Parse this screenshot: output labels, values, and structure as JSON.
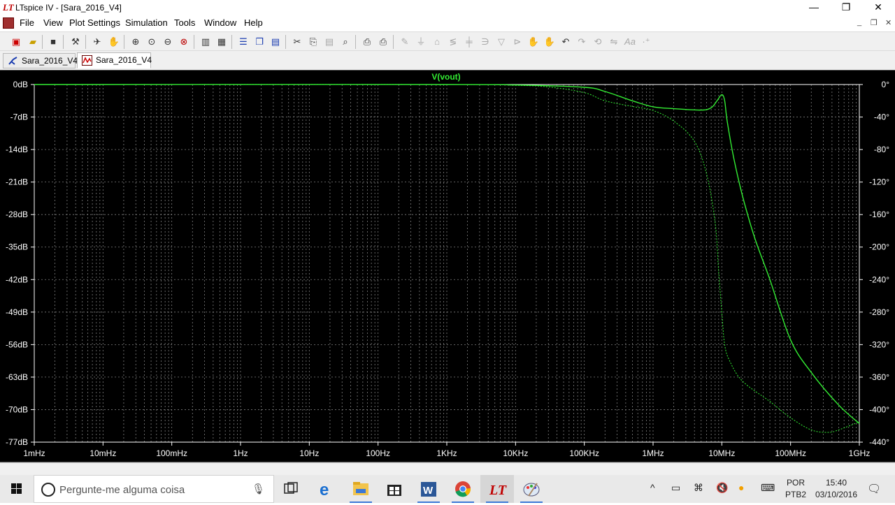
{
  "window": {
    "title": "LTspice IV - [Sara_2016_V4]",
    "app_logo": "LT",
    "controls": {
      "minimize": "—",
      "restore": "❐",
      "close": "✕"
    },
    "mdi_controls": {
      "minimize": "_",
      "restore": "❐",
      "close": "✕"
    }
  },
  "menu": [
    "File",
    "View",
    "Plot Settings",
    "Simulation",
    "Tools",
    "Window",
    "Help"
  ],
  "toolbar_icons": [
    "new-schematic",
    "open",
    "save",
    "control-panel",
    "run",
    "pan",
    "zoom-in",
    "zoom-full",
    "zoom-out",
    "cancel-zoom",
    "autorange",
    "zoom-to-fit",
    "tile-horizontal",
    "cascade",
    "tile-vertical",
    "cut",
    "copy",
    "paste",
    "find",
    "print-preview",
    "print",
    "wire",
    "ground",
    "label-net",
    "resistor",
    "capacitor",
    "inductor",
    "diode",
    "component",
    "move",
    "drag",
    "undo",
    "redo",
    "rotate",
    "mirror",
    "text",
    "spice-directive"
  ],
  "tabs": [
    {
      "label": "Sara_2016_V4",
      "icon": "schematic-icon",
      "active": false
    },
    {
      "label": "Sara_2016_V4",
      "icon": "waveform-icon",
      "active": true
    }
  ],
  "plot": {
    "trace_label": "V(vout)",
    "trace_color": "#33ee33",
    "background": "#000000",
    "grid_color": "#808080",
    "left_axis_ticks": [
      "0dB",
      "-7dB",
      "-14dB",
      "-21dB",
      "-28dB",
      "-35dB",
      "-42dB",
      "-49dB",
      "-56dB",
      "-63dB",
      "-70dB",
      "-77dB"
    ],
    "right_axis_ticks": [
      "0°",
      "-40°",
      "-80°",
      "-120°",
      "-160°",
      "-200°",
      "-240°",
      "-280°",
      "-320°",
      "-360°",
      "-400°",
      "-440°"
    ],
    "x_axis_ticks": [
      "1mHz",
      "10mHz",
      "100mHz",
      "1Hz",
      "10Hz",
      "100Hz",
      "1KHz",
      "10KHz",
      "100KHz",
      "1MHz",
      "10MHz",
      "100MHz",
      "1GHz"
    ]
  },
  "chart_data": {
    "type": "line",
    "title": "V(vout)",
    "x_scale": "log",
    "xlim": [
      "1mHz",
      "1GHz"
    ],
    "ylim_left_db": [
      -77,
      0
    ],
    "ylim_right_deg": [
      -440,
      0
    ],
    "grid": true,
    "series": [
      {
        "axis": "magnitude_db",
        "style": "solid",
        "x_hz": [
          0.001,
          1000,
          10000,
          100000,
          200000,
          500000,
          1000000,
          2000000,
          5000000,
          7000000,
          8500000,
          10000000,
          11000000,
          12000000,
          15000000,
          20000000,
          30000000,
          50000000,
          100000000,
          200000000,
          500000000,
          1000000000
        ],
        "y": [
          0,
          0,
          -0.1,
          -0.6,
          -1.5,
          -3.5,
          -4.8,
          -5.2,
          -5.5,
          -5.0,
          -3.5,
          -2.2,
          -3.5,
          -8.0,
          -16,
          -24,
          -33,
          -42,
          -55,
          -62,
          -69,
          -73
        ]
      },
      {
        "axis": "phase_deg",
        "style": "dotted",
        "x_hz": [
          0.001,
          1000,
          10000,
          30000,
          100000,
          200000,
          500000,
          1000000,
          2000000,
          4000000,
          6000000,
          8000000,
          9000000,
          10000000,
          11000000,
          13000000,
          20000000,
          50000000,
          100000000,
          200000000,
          350000000,
          500000000,
          1000000000
        ],
        "y": [
          0,
          0,
          -1,
          -3,
          -10,
          -20,
          -27,
          -32,
          -45,
          -70,
          -110,
          -170,
          -230,
          -280,
          -320,
          -340,
          -365,
          -390,
          -410,
          -425,
          -428,
          -425,
          -415
        ]
      }
    ]
  },
  "taskbar": {
    "search_placeholder": "Pergunte-me alguma coisa",
    "apps": [
      "task-view",
      "edge",
      "file-explorer",
      "store",
      "word",
      "chrome",
      "ltspice",
      "paint"
    ],
    "tray_language": "POR",
    "tray_layout": "PTB2",
    "time": "15:40",
    "date": "03/10/2016"
  }
}
